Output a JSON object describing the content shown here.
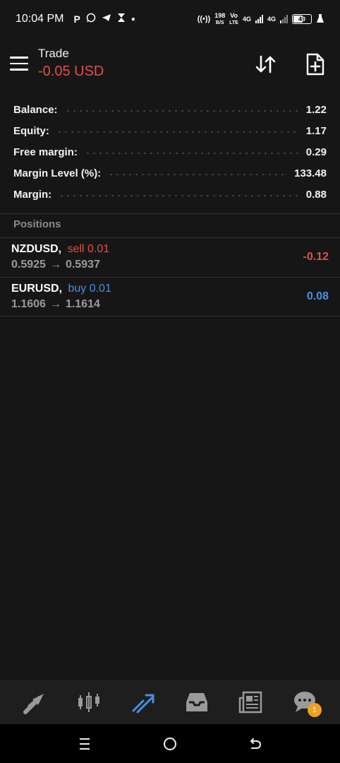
{
  "status_bar": {
    "time": "10:04 PM",
    "speed": "198",
    "speed_unit": "B/S",
    "volte_top": "Vo",
    "volte_bottom": "LTE",
    "net1": "4G",
    "net2": "4G",
    "battery": "49"
  },
  "header": {
    "title": "Trade",
    "total_pnl": "-0.05 USD"
  },
  "summary": [
    {
      "label": "Balance:",
      "value": "1.22"
    },
    {
      "label": "Equity:",
      "value": "1.17"
    },
    {
      "label": "Free margin:",
      "value": "0.29"
    },
    {
      "label": "Margin Level (%):",
      "value": "133.48"
    },
    {
      "label": "Margin:",
      "value": "0.88"
    }
  ],
  "positions_header": "Positions",
  "positions": [
    {
      "symbol": "NZDUSD,",
      "side": "sell 0.01",
      "side_type": "sell",
      "open_price": "0.5925",
      "arrow": "→",
      "current_price": "0.5937",
      "profit": "-0.12"
    },
    {
      "symbol": "EURUSD,",
      "side": "buy 0.01",
      "side_type": "buy",
      "open_price": "1.1606",
      "arrow": "→",
      "current_price": "1.1614",
      "profit": "0.08"
    }
  ],
  "bottom_nav": {
    "items": [
      "quotes",
      "chart",
      "trade",
      "history",
      "news",
      "messages"
    ],
    "active": "trade",
    "messages_badge": "1"
  },
  "colors": {
    "background": "#161616",
    "negative": "#e0504a",
    "positive_buy": "#4a90e2",
    "badge": "#f0a020"
  }
}
